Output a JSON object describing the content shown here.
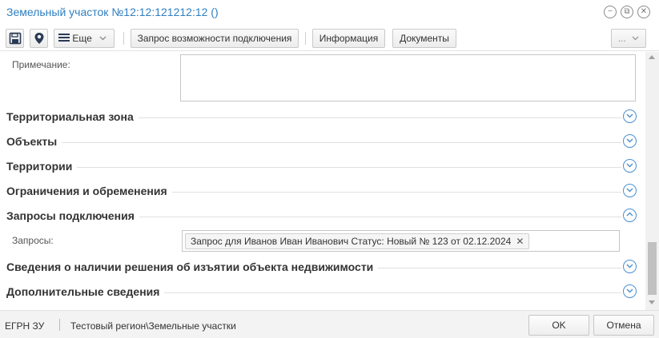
{
  "window": {
    "title": "Земельный участок №12:12:121212:12 ()",
    "controls": [
      "minimize-icon",
      "restore-icon",
      "close-icon"
    ]
  },
  "toolbar": {
    "save_icon": "floppy-disk-icon",
    "location_icon": "map-pin-icon",
    "more_label": "Еще",
    "connection_request_label": "Запрос возможности подключения",
    "info_label": "Информация",
    "documents_label": "Документы",
    "overflow_label": "..."
  },
  "form": {
    "note_label": "Примечание:",
    "note_value": "",
    "sections": [
      {
        "title": "Территориальная зона",
        "expanded": false
      },
      {
        "title": "Объекты",
        "expanded": false
      },
      {
        "title": "Территории",
        "expanded": false
      },
      {
        "title": "Ограничения и обременения",
        "expanded": false
      },
      {
        "title": "Запросы подключения",
        "expanded": true
      },
      {
        "title": "Сведения о наличии решения об изъятии объекта недвижимости",
        "expanded": false
      },
      {
        "title": "Дополнительные сведения",
        "expanded": false
      }
    ],
    "requests_label": "Запросы:",
    "requests": [
      "Запрос для Иванов Иван Иванович Статус: Новый № 123 от 02.12.2024"
    ]
  },
  "statusbar": {
    "registry": "ЕГРН ЗУ",
    "path": "Тестовый регион\\Земельные участки",
    "ok_label": "OK",
    "cancel_label": "Отмена"
  },
  "colors": {
    "title": "#2f7fc1",
    "chevron": "#4a8fd0",
    "border": "#c6c6c6"
  }
}
